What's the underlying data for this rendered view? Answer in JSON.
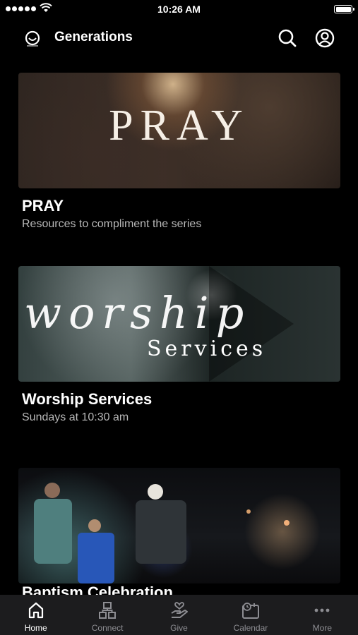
{
  "status_bar": {
    "time": "10:26 AM"
  },
  "header": {
    "title": "Generations"
  },
  "feed": [
    {
      "title": "PRAY",
      "subtitle": "Resources to compliment the series",
      "image_text": "PRAY"
    },
    {
      "title": "Worship Services",
      "subtitle": "Sundays at 10:30 am",
      "image_text_script": "worship",
      "image_text_sub": "Services"
    },
    {
      "title": "Baptism Celebration",
      "subtitle": ""
    }
  ],
  "tab_bar": [
    {
      "label": "Home",
      "icon": "home-icon",
      "active": true
    },
    {
      "label": "Connect",
      "icon": "connect-icon",
      "active": false
    },
    {
      "label": "Give",
      "icon": "give-icon",
      "active": false
    },
    {
      "label": "Calendar",
      "icon": "calendar-icon",
      "active": false
    },
    {
      "label": "More",
      "icon": "more-icon",
      "active": false
    }
  ],
  "colors": {
    "background": "#000000",
    "tab_bar": "#1c1c1e",
    "inactive_tab": "#8d8d92",
    "subtitle": "#b8b8b8"
  }
}
